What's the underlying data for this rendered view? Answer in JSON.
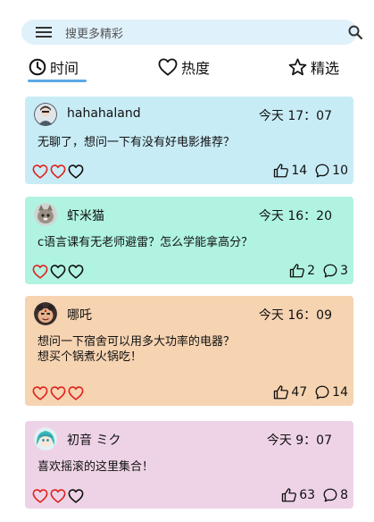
{
  "search": {
    "placeholder": "搜更多精彩",
    "menu_icon": "hamburger-menu-icon",
    "search_icon": "search-icon"
  },
  "tabs": [
    {
      "label": "时间",
      "icon": "clock-icon",
      "active": true
    },
    {
      "label": "热度",
      "icon": "heart-outline-icon",
      "active": false
    },
    {
      "label": "精选",
      "icon": "star-outline-icon",
      "active": false
    }
  ],
  "colors": {
    "accent": "#5aa9e6",
    "heart": "#e0211c",
    "card_blue": "#c8ecf6",
    "card_mint": "#b0f3e1",
    "card_peach": "#f6d3b1",
    "card_pink": "#eed3e6"
  },
  "posts": [
    {
      "user": "hahahaland",
      "time": "今天 17：07",
      "content": "无聊了，想问一下有没有好电影推荐？",
      "hearts_filled": 2,
      "likes": "14",
      "comments": "10"
    },
    {
      "user": "虾米猫",
      "time": "今天 16：20",
      "content": "c语言课有无老师避雷？怎么学能拿高分？",
      "hearts_filled": 1,
      "likes": "2",
      "comments": "3"
    },
    {
      "user": "哪吒",
      "time": "今天 16：09",
      "content": "想问一下宿舍可以用多大功率的电器？\n想买个锅煮火锅吃！",
      "hearts_filled": 3,
      "likes": "47",
      "comments": "14"
    },
    {
      "user": "初音 ミク",
      "time": "今天 9：07",
      "content": "喜欢摇滚的这里集合！",
      "hearts_filled": 2,
      "likes": "63",
      "comments": "8"
    }
  ]
}
